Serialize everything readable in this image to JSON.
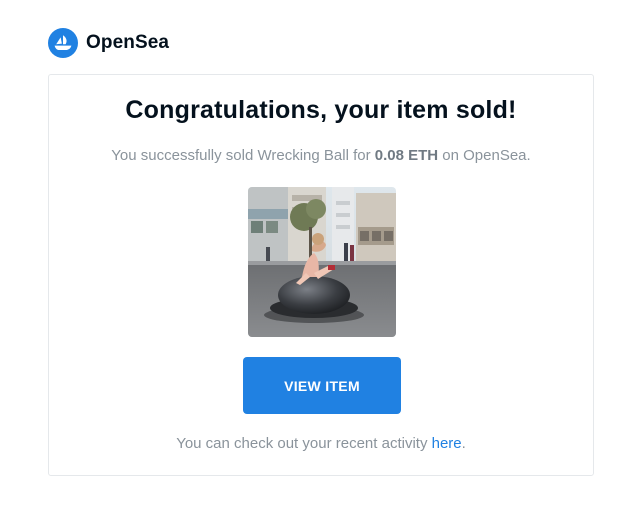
{
  "brand": {
    "name": "OpenSea",
    "color": "#2081e2"
  },
  "email": {
    "title": "Congratulations, your item sold!",
    "message_prefix": "You successfully sold Wrecking Ball for ",
    "amount": "0.08 ETH",
    "message_suffix": " on OpenSea.",
    "image_alt": "Wrecking Ball",
    "button_label": "VIEW ITEM",
    "button_color": "#2081e2",
    "footer_prefix": "You can check out your recent activity ",
    "footer_link": "here",
    "footer_suffix": "."
  }
}
